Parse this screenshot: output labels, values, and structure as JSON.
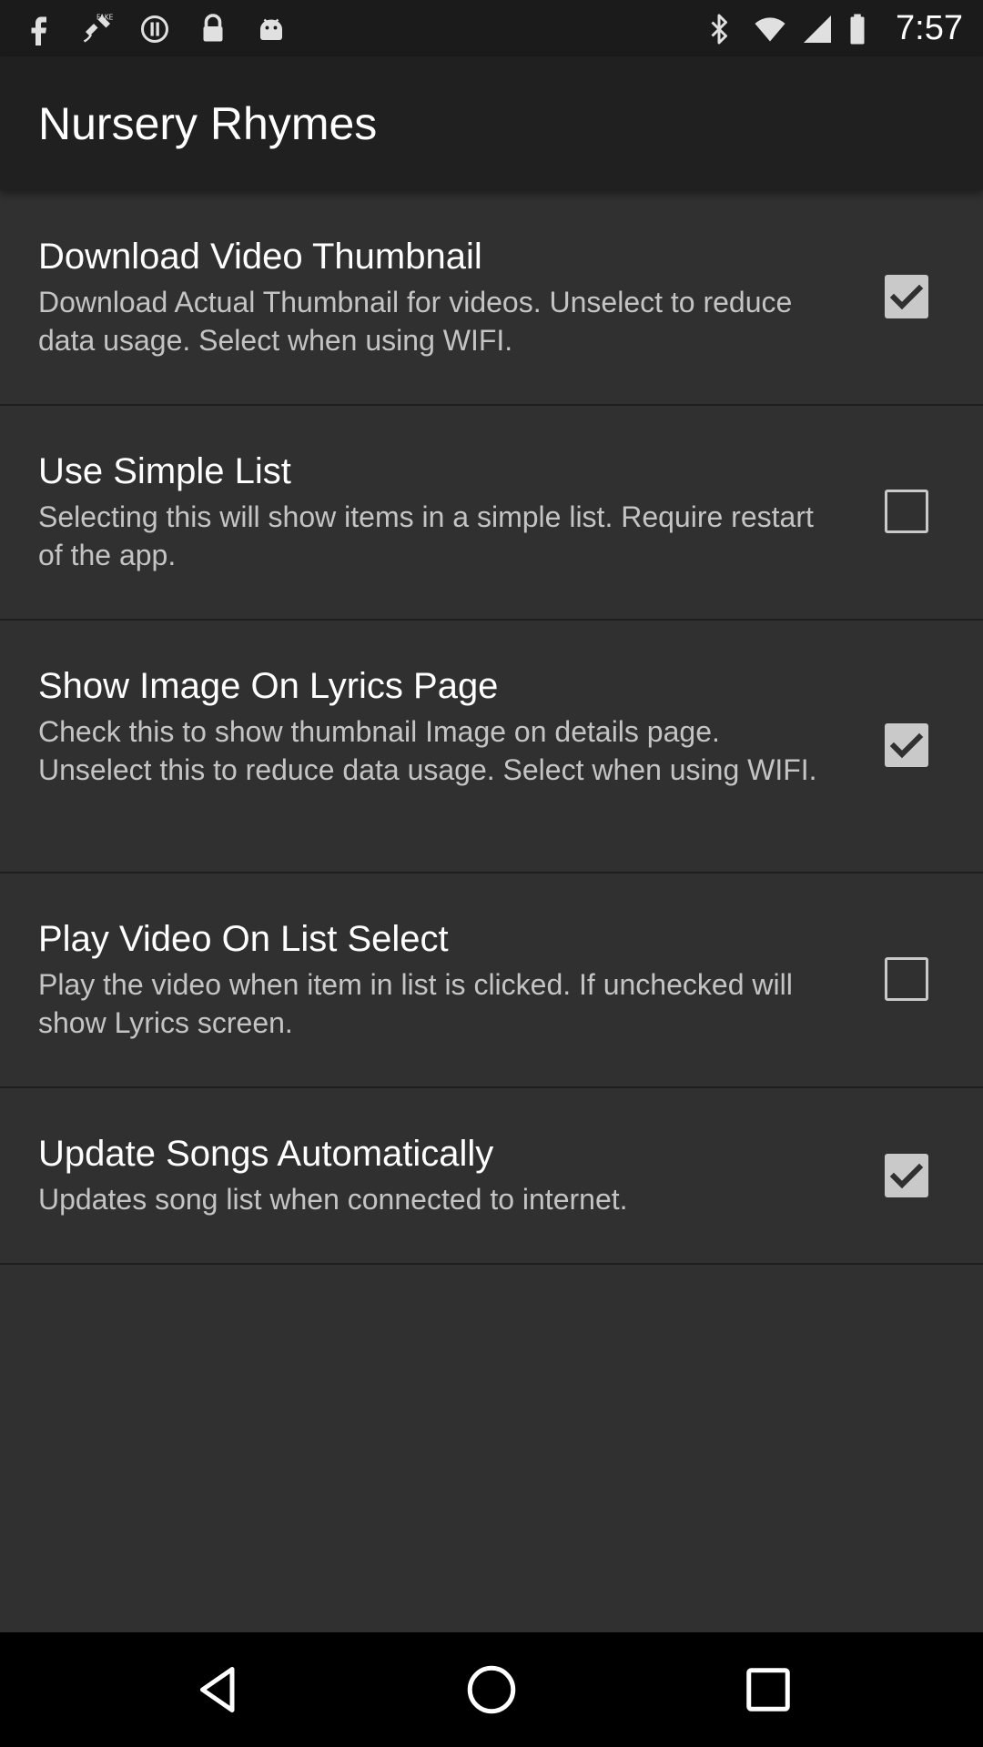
{
  "status_bar": {
    "time": "7:57",
    "left_icons": [
      "facebook-icon",
      "fake-gps-icon",
      "sync-icon",
      "lock-icon",
      "android-icon"
    ],
    "right_icons": [
      "bluetooth-icon",
      "wifi-icon",
      "signal-icon",
      "battery-icon"
    ]
  },
  "app_bar": {
    "title": "Nursery Rhymes"
  },
  "settings": [
    {
      "title": "Download Video Thumbnail",
      "summary": "Download Actual Thumbnail for videos. Unselect to reduce data usage. Select when using WIFI.",
      "checked": true
    },
    {
      "title": "Use Simple List",
      "summary": "Selecting this will show items in a simple list. Require restart of the app.",
      "checked": false
    },
    {
      "title": "Show Image On Lyrics Page",
      "summary": "Check this to show thumbnail Image on details page. Unselect this to reduce data usage. Select when using WIFI.",
      "checked": true
    },
    {
      "title": "Play Video On List Select",
      "summary": "Play the video when item in list is clicked. If unchecked will show Lyrics screen.",
      "checked": false
    },
    {
      "title": "Update Songs Automatically",
      "summary": "Updates song list when connected to internet.",
      "checked": true
    }
  ],
  "nav_bar": {
    "buttons": [
      "back-icon",
      "home-icon",
      "recents-icon"
    ]
  },
  "colors": {
    "background": "#303030",
    "app_bar": "#202020",
    "status_bar": "#1b1b1b",
    "checkbox": "#c9c9c9",
    "check_mark": "#303030"
  }
}
